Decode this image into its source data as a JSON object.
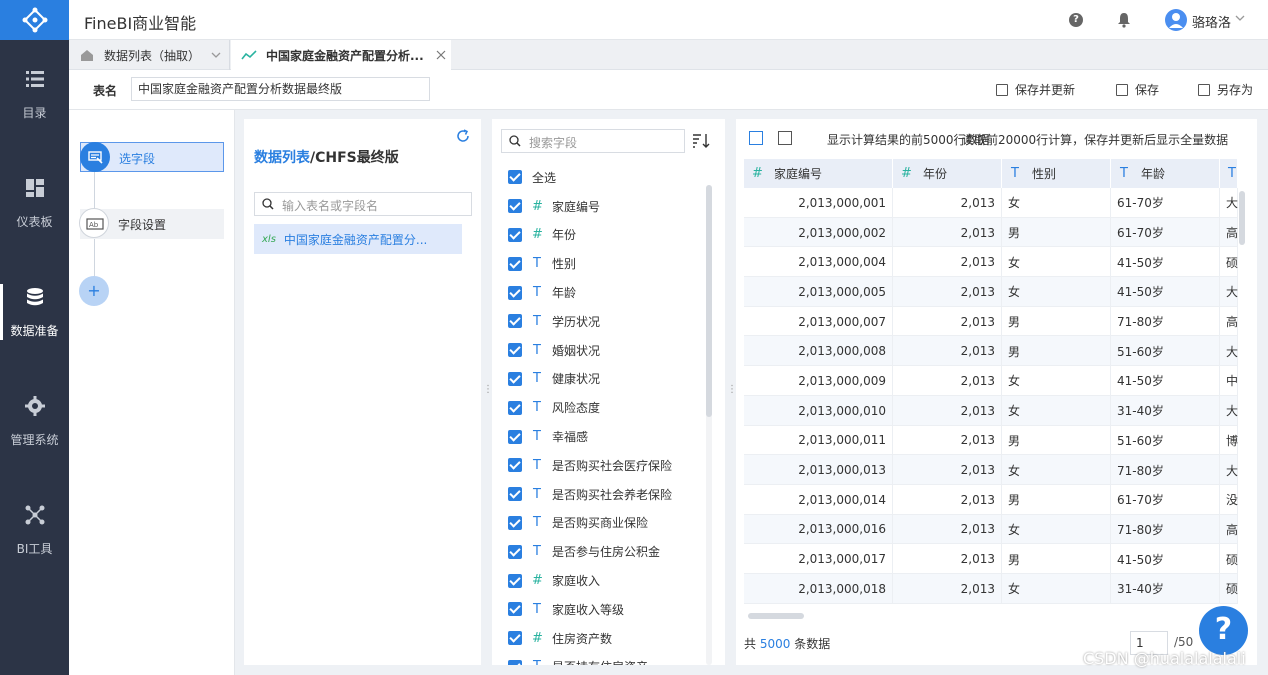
{
  "app": {
    "title": "FineBI商业智能",
    "user": "骆珞洛"
  },
  "nav": [
    {
      "label": "目录",
      "icon": "list-icon"
    },
    {
      "label": "仪表板",
      "icon": "dashboard-icon"
    },
    {
      "label": "数据准备",
      "icon": "database-icon",
      "active": true
    },
    {
      "label": "管理系统",
      "icon": "gear-icon"
    },
    {
      "label": "BI工具",
      "icon": "network-icon"
    }
  ],
  "tabs": [
    {
      "label": "数据列表（抽取）",
      "icon": "home-icon"
    },
    {
      "label": "中国家庭金融资产配置分析...",
      "icon": "chart-line-icon"
    }
  ],
  "namebar": {
    "label": "表名",
    "value": "中国家庭金融资产配置分析数据最终版",
    "save_update": "保存并更新",
    "save": "保存",
    "save_as": "另存为"
  },
  "steps": {
    "select_fields": "选字段",
    "field_settings": "字段设置",
    "add": "+"
  },
  "source": {
    "title_link": "数据列表",
    "title_rest": "/CHFS最终版",
    "search_placeholder": "输入表名或字段名",
    "file": "中国家庭金融资产配置分..."
  },
  "fields": {
    "search_placeholder": "搜索字段",
    "items": [
      {
        "label": "全选",
        "type": ""
      },
      {
        "label": "家庭编号",
        "type": "#"
      },
      {
        "label": "年份",
        "type": "#"
      },
      {
        "label": "性别",
        "type": "T"
      },
      {
        "label": "年龄",
        "type": "T"
      },
      {
        "label": "学历状况",
        "type": "T"
      },
      {
        "label": "婚姻状况",
        "type": "T"
      },
      {
        "label": "健康状况",
        "type": "T"
      },
      {
        "label": "风险态度",
        "type": "T"
      },
      {
        "label": "幸福感",
        "type": "T"
      },
      {
        "label": "是否购买社会医疗保险",
        "type": "T"
      },
      {
        "label": "是否购买社会养老保险",
        "type": "T"
      },
      {
        "label": "是否购买商业保险",
        "type": "T"
      },
      {
        "label": "是否参与住房公积金",
        "type": "T"
      },
      {
        "label": "家庭收入",
        "type": "#"
      },
      {
        "label": "家庭收入等级",
        "type": "T"
      },
      {
        "label": "住房资产数",
        "type": "#"
      },
      {
        "label": "是否持有住房资产",
        "type": "T"
      }
    ]
  },
  "preview": {
    "note": "显示计算结果的前5000行数据",
    "note_overlap": "读取前20000行计算，保存并更新后显示全量数据",
    "columns": [
      {
        "label": "家庭编号",
        "type": "#"
      },
      {
        "label": "年份",
        "type": "#"
      },
      {
        "label": "性别",
        "type": "T"
      },
      {
        "label": "年龄",
        "type": "T"
      },
      {
        "label": "",
        "type": "T"
      }
    ],
    "rows": [
      [
        "2,013,000,001",
        "2,013",
        "女",
        "61-70岁",
        "大"
      ],
      [
        "2,013,000,002",
        "2,013",
        "男",
        "61-70岁",
        "高"
      ],
      [
        "2,013,000,004",
        "2,013",
        "女",
        "41-50岁",
        "硕"
      ],
      [
        "2,013,000,005",
        "2,013",
        "女",
        "41-50岁",
        "大"
      ],
      [
        "2,013,000,007",
        "2,013",
        "男",
        "71-80岁",
        "高"
      ],
      [
        "2,013,000,008",
        "2,013",
        "男",
        "51-60岁",
        "大"
      ],
      [
        "2,013,000,009",
        "2,013",
        "女",
        "41-50岁",
        "中"
      ],
      [
        "2,013,000,010",
        "2,013",
        "女",
        "31-40岁",
        "大"
      ],
      [
        "2,013,000,011",
        "2,013",
        "男",
        "51-60岁",
        "博"
      ],
      [
        "2,013,000,013",
        "2,013",
        "女",
        "71-80岁",
        "大"
      ],
      [
        "2,013,000,014",
        "2,013",
        "男",
        "61-70岁",
        "没"
      ],
      [
        "2,013,000,016",
        "2,013",
        "女",
        "71-80岁",
        "高"
      ],
      [
        "2,013,000,017",
        "2,013",
        "男",
        "41-50岁",
        "硕"
      ],
      [
        "2,013,000,018",
        "2,013",
        "女",
        "31-40岁",
        "硕"
      ]
    ],
    "total_prefix": "共",
    "total_count": "5000",
    "total_suffix": "条数据",
    "page": "1",
    "page_total": "/50"
  },
  "fab": "?",
  "watermark": "CSDN @hualalalalali"
}
